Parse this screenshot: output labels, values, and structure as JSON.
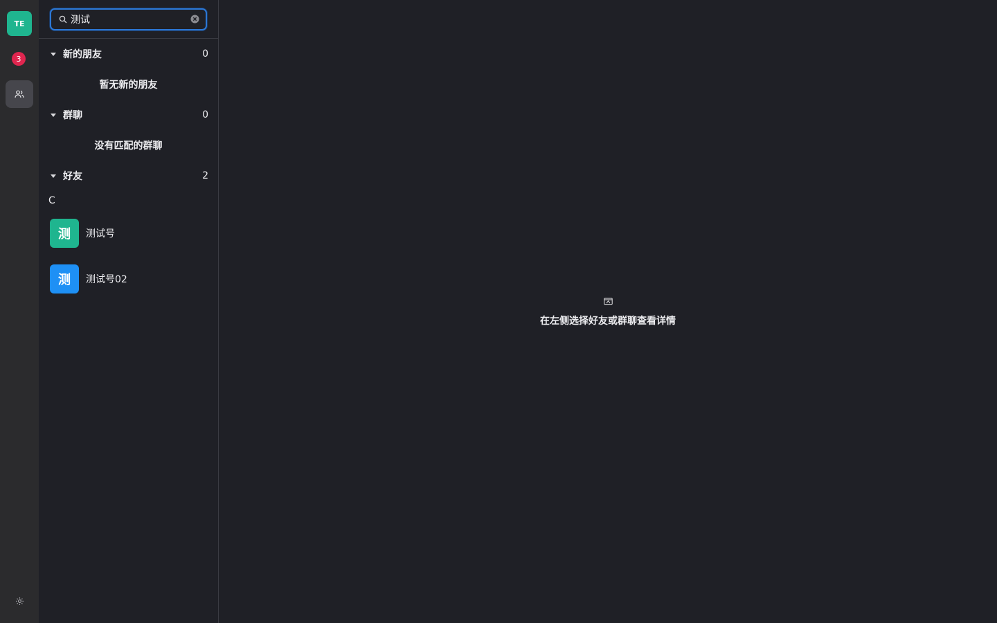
{
  "rail": {
    "avatar_initials": "TE",
    "chat_badge": "3",
    "accent_color": "#1fb58f",
    "badge_color": "#e0264f"
  },
  "search": {
    "value": "测试",
    "placeholder": "搜索"
  },
  "sections": {
    "new_friends": {
      "title": "新的朋友",
      "count": "0",
      "empty_text": "暂无新的朋友"
    },
    "groups": {
      "title": "群聊",
      "count": "0",
      "empty_text": "没有匹配的群聊"
    },
    "friends": {
      "title": "好友",
      "count": "2"
    }
  },
  "friends_list": {
    "letter": "C",
    "items": [
      {
        "avatar_char": "测",
        "name": "测试号",
        "avatar_color": "#1fb58f"
      },
      {
        "avatar_char": "测",
        "name": "测试号02",
        "avatar_color": "#1e90f5"
      }
    ]
  },
  "main": {
    "placeholder_text": "在左侧选择好友或群聊查看详情",
    "icon": "id-card-icon"
  }
}
